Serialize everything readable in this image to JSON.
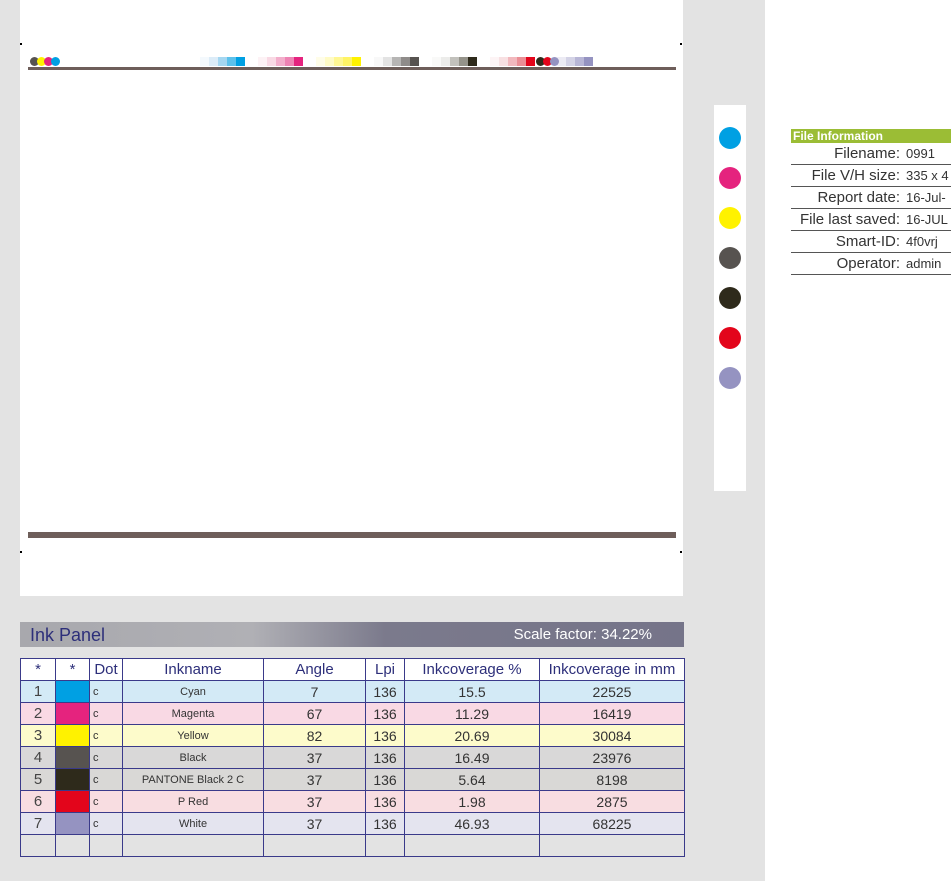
{
  "colors": {
    "cyan": "#00a0e3",
    "magenta": "#e5237e",
    "yellow": "#fff200",
    "black": "#575350",
    "pantone": "#2e2a1b",
    "red": "#e3051b",
    "white": "#9593c1"
  },
  "file_info": {
    "title": "File Information",
    "rows": [
      {
        "label": "Filename:",
        "value": "0991"
      },
      {
        "label": "File V/H size:",
        "value": "335 x 4"
      },
      {
        "label": "Report date:",
        "value": "16-Jul-"
      },
      {
        "label": "File last saved:",
        "value": "16-JUL"
      },
      {
        "label": "Smart-ID:",
        "value": "4f0vrj"
      },
      {
        "label": "Operator:",
        "value": "admin"
      }
    ]
  },
  "ink_panel": {
    "title": "Ink Panel",
    "scale_factor": "Scale factor: 34.22%",
    "headers": [
      "*",
      "*",
      "Dot",
      "Inkname",
      "Angle",
      "Lpi",
      "Inkcoverage %",
      "Inkcoverage in mm"
    ],
    "rows": [
      {
        "n": "1",
        "dot": "c",
        "name": "Cyan",
        "angle": "7",
        "lpi": "136",
        "pct": "15.5",
        "mm": "22525",
        "color": "#00a0e3",
        "bg": "#d3eaf6"
      },
      {
        "n": "2",
        "dot": "c",
        "name": "Magenta",
        "angle": "67",
        "lpi": "136",
        "pct": "11.29",
        "mm": "16419",
        "color": "#e5237e",
        "bg": "#f9d9e4"
      },
      {
        "n": "3",
        "dot": "c",
        "name": "Yellow",
        "angle": "82",
        "lpi": "136",
        "pct": "20.69",
        "mm": "30084",
        "color": "#fff200",
        "bg": "#fdfbcb"
      },
      {
        "n": "4",
        "dot": "c",
        "name": "Black",
        "angle": "37",
        "lpi": "136",
        "pct": "16.49",
        "mm": "23976",
        "color": "#575350",
        "bg": "#d9d8d8"
      },
      {
        "n": "5",
        "dot": "c",
        "name": "PANTONE Black 2 C",
        "angle": "37",
        "lpi": "136",
        "pct": "5.64",
        "mm": "8198",
        "color": "#2e2a1b",
        "bg": "#d9d8d6"
      },
      {
        "n": "6",
        "dot": "c",
        "name": "P Red",
        "angle": "37",
        "lpi": "136",
        "pct": "1.98",
        "mm": "2875",
        "color": "#e3051b",
        "bg": "#f8dde1"
      },
      {
        "n": "7",
        "dot": "c",
        "name": "White",
        "angle": "37",
        "lpi": "136",
        "pct": "46.93",
        "mm": "68225",
        "color": "#9593c1",
        "bg": "#e4e4ef"
      }
    ]
  }
}
